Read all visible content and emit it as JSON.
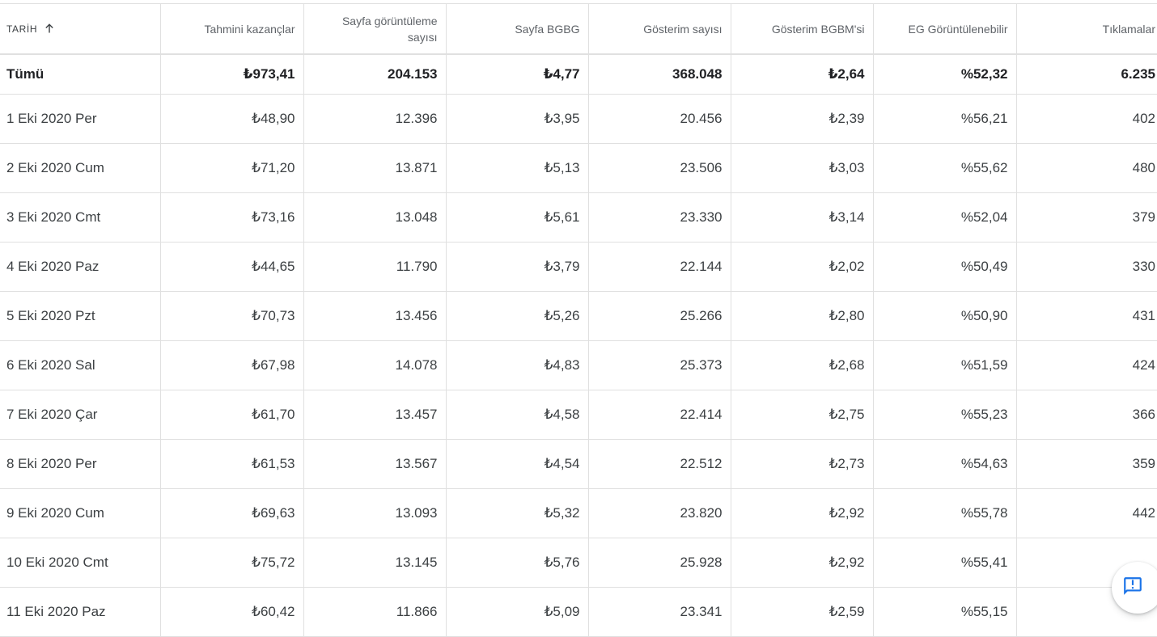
{
  "columns": {
    "date": "TARİH",
    "earnings": "Tahmini kazançlar",
    "pageviews": "Sayfa görüntüleme sayısı",
    "page_rpm": "Sayfa BGBG",
    "impressions": "Gösterim sayısı",
    "impression_rpm": "Gösterim BGBM'si",
    "viewable": "EG Görüntülenebilir",
    "clicks": "Tıklamalar"
  },
  "total": {
    "label": "Tümü",
    "earnings": "₺973,41",
    "pageviews": "204.153",
    "page_rpm": "₺4,77",
    "impressions": "368.048",
    "impression_rpm": "₺2,64",
    "viewable": "%52,32",
    "clicks": "6.235"
  },
  "rows": [
    {
      "date": "1 Eki 2020 Per",
      "earnings": "₺48,90",
      "pageviews": "12.396",
      "page_rpm": "₺3,95",
      "impressions": "20.456",
      "impression_rpm": "₺2,39",
      "viewable": "%56,21",
      "clicks": "402"
    },
    {
      "date": "2 Eki 2020 Cum",
      "earnings": "₺71,20",
      "pageviews": "13.871",
      "page_rpm": "₺5,13",
      "impressions": "23.506",
      "impression_rpm": "₺3,03",
      "viewable": "%55,62",
      "clicks": "480"
    },
    {
      "date": "3 Eki 2020 Cmt",
      "earnings": "₺73,16",
      "pageviews": "13.048",
      "page_rpm": "₺5,61",
      "impressions": "23.330",
      "impression_rpm": "₺3,14",
      "viewable": "%52,04",
      "clicks": "379"
    },
    {
      "date": "4 Eki 2020 Paz",
      "earnings": "₺44,65",
      "pageviews": "11.790",
      "page_rpm": "₺3,79",
      "impressions": "22.144",
      "impression_rpm": "₺2,02",
      "viewable": "%50,49",
      "clicks": "330"
    },
    {
      "date": "5 Eki 2020 Pzt",
      "earnings": "₺70,73",
      "pageviews": "13.456",
      "page_rpm": "₺5,26",
      "impressions": "25.266",
      "impression_rpm": "₺2,80",
      "viewable": "%50,90",
      "clicks": "431"
    },
    {
      "date": "6 Eki 2020 Sal",
      "earnings": "₺67,98",
      "pageviews": "14.078",
      "page_rpm": "₺4,83",
      "impressions": "25.373",
      "impression_rpm": "₺2,68",
      "viewable": "%51,59",
      "clicks": "424"
    },
    {
      "date": "7 Eki 2020 Çar",
      "earnings": "₺61,70",
      "pageviews": "13.457",
      "page_rpm": "₺4,58",
      "impressions": "22.414",
      "impression_rpm": "₺2,75",
      "viewable": "%55,23",
      "clicks": "366"
    },
    {
      "date": "8 Eki 2020 Per",
      "earnings": "₺61,53",
      "pageviews": "13.567",
      "page_rpm": "₺4,54",
      "impressions": "22.512",
      "impression_rpm": "₺2,73",
      "viewable": "%54,63",
      "clicks": "359"
    },
    {
      "date": "9 Eki 2020 Cum",
      "earnings": "₺69,63",
      "pageviews": "13.093",
      "page_rpm": "₺5,32",
      "impressions": "23.820",
      "impression_rpm": "₺2,92",
      "viewable": "%55,78",
      "clicks": "442"
    },
    {
      "date": "10 Eki 2020 Cmt",
      "earnings": "₺75,72",
      "pageviews": "13.145",
      "page_rpm": "₺5,76",
      "impressions": "25.928",
      "impression_rpm": "₺2,92",
      "viewable": "%55,41",
      "clicks": ""
    },
    {
      "date": "11 Eki 2020 Paz",
      "earnings": "₺60,42",
      "pageviews": "11.866",
      "page_rpm": "₺5,09",
      "impressions": "23.341",
      "impression_rpm": "₺2,59",
      "viewable": "%55,15",
      "clicks": ""
    }
  ],
  "icons": {
    "sort": "arrow-upward-icon",
    "feedback": "feedback-icon"
  },
  "colors": {
    "accent": "#1a73e8",
    "grid": "#e0e0e0",
    "header_text": "#5f6368"
  }
}
